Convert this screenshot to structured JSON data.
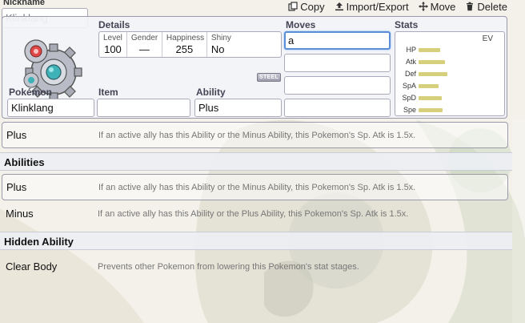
{
  "nickname": {
    "label": "Nickname",
    "value": "Klinklang"
  },
  "toolbar": {
    "copy": "Copy",
    "import_export": "Import/Export",
    "move": "Move",
    "delete": "Delete"
  },
  "details": {
    "label": "Details",
    "level_label": "Level",
    "level": "100",
    "gender_label": "Gender",
    "gender": "—",
    "happiness_label": "Happiness",
    "happiness": "255",
    "shiny_label": "Shiny",
    "shiny": "No"
  },
  "type_badge": "STEEL",
  "pokemon": {
    "label": "Pokémon",
    "value": "Klinklang"
  },
  "item": {
    "label": "Item",
    "value": ""
  },
  "ability": {
    "label": "Ability",
    "value": "Plus"
  },
  "moves": {
    "label": "Moves",
    "values": [
      "a",
      "",
      "",
      ""
    ]
  },
  "stats": {
    "label": "Stats",
    "ev_label": "EV",
    "rows": [
      {
        "name": "HP",
        "level": 0.21
      },
      {
        "name": "Atk",
        "level": 0.25
      },
      {
        "name": "Def",
        "level": 0.28
      },
      {
        "name": "SpA",
        "level": 0.19
      },
      {
        "name": "SpD",
        "level": 0.22
      },
      {
        "name": "Spe",
        "level": 0.23
      }
    ]
  },
  "current_result": {
    "name": "Plus",
    "desc": "If an active ally has this Ability or the Minus Ability, this Pokemon's Sp. Atk is 1.5x."
  },
  "abilities": {
    "header": "Abilities",
    "items": [
      {
        "name": "Plus",
        "desc": "If an active ally has this Ability or the Minus Ability, this Pokemon's Sp. Atk is 1.5x."
      },
      {
        "name": "Minus",
        "desc": "If an active ally has this Ability or the Plus Ability, this Pokemon's Sp. Atk is 1.5x."
      }
    ]
  },
  "hidden_ability": {
    "header": "Hidden Ability",
    "items": [
      {
        "name": "Clear Body",
        "desc": "Prevents other Pokemon from lowering this Pokemon's stat stages."
      }
    ]
  },
  "colors": {
    "accent_focus": "#5a8fd8",
    "stat_bar": "#d6d07c",
    "steel_badge": "#9c9cac"
  }
}
